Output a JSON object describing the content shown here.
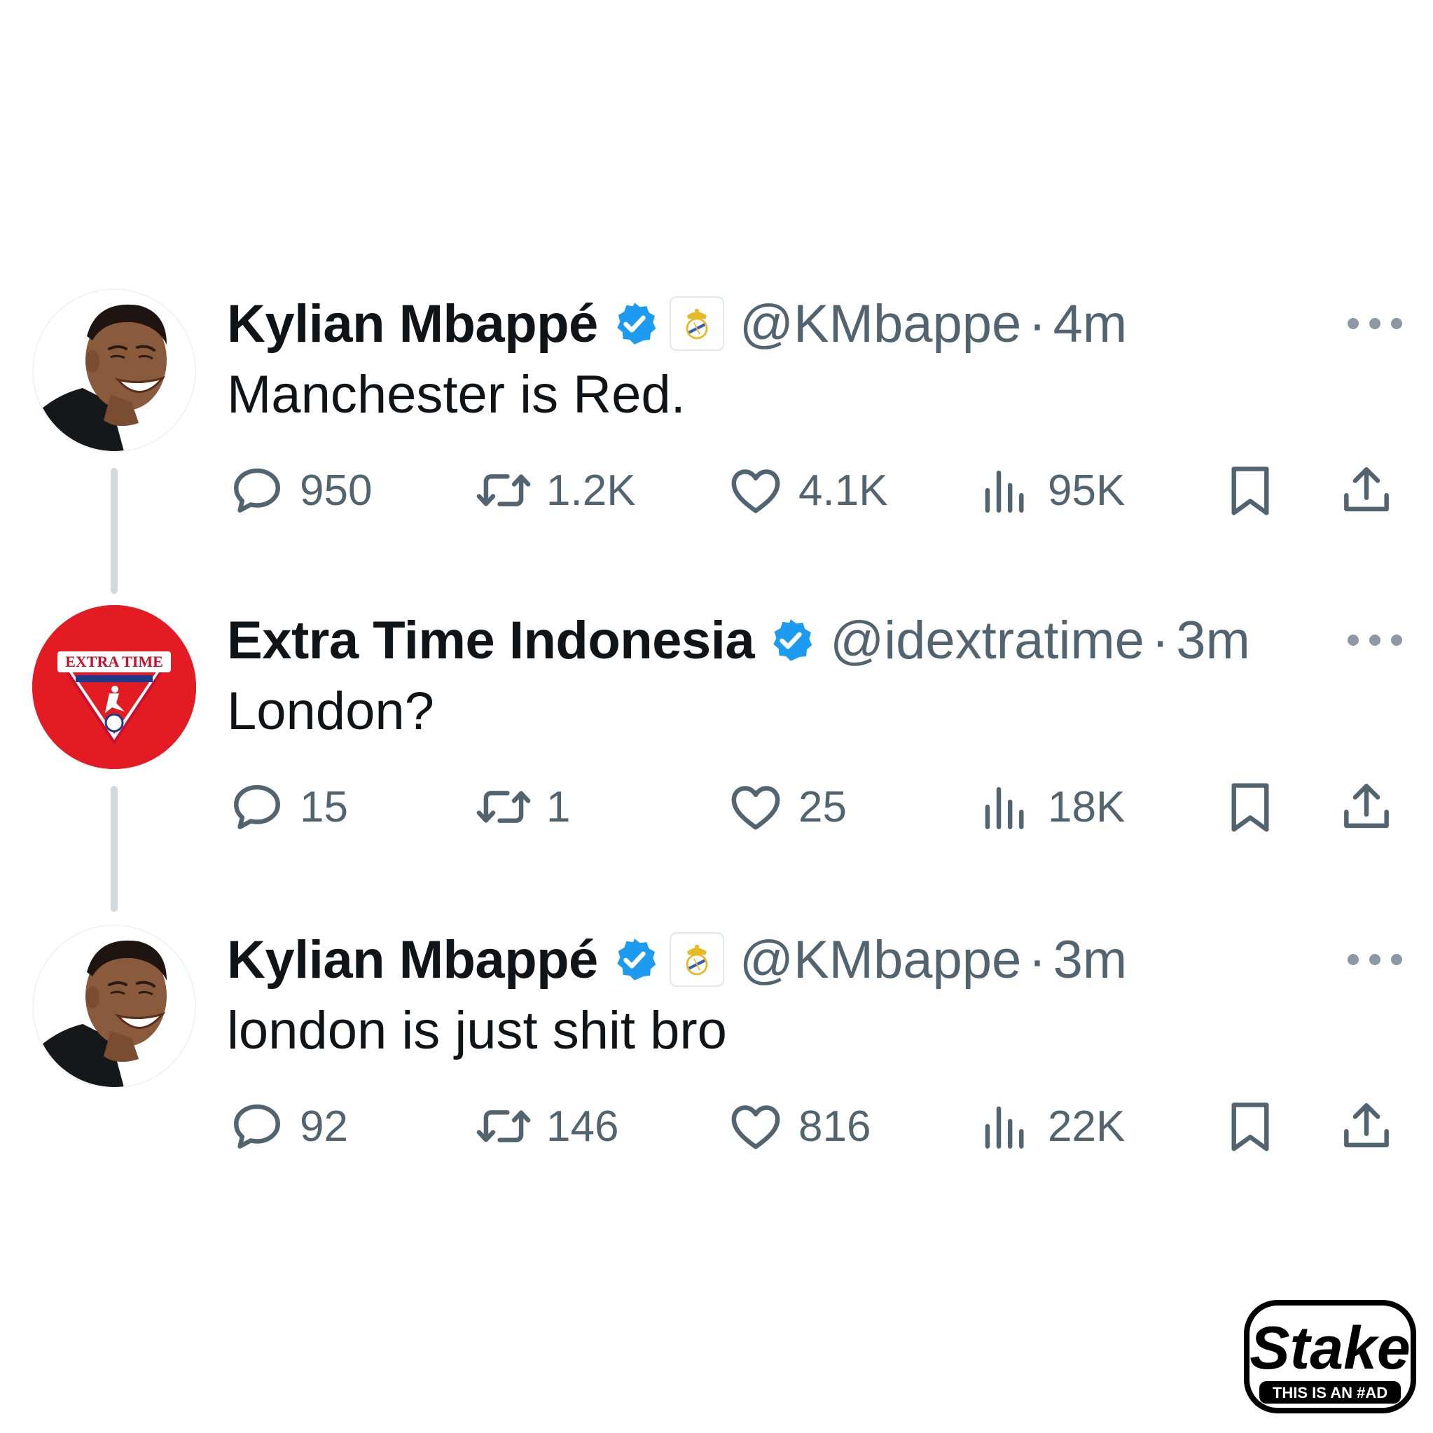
{
  "tweets": [
    {
      "name": "Kylian Mbappé",
      "handle": "@KMbappe",
      "dot": "·",
      "time": "4m",
      "text": "Manchester is Red.",
      "replies": "950",
      "retweets": "1.2K",
      "likes": "4.1K",
      "views": "95K",
      "avatar": "person-photo",
      "affiliate_badge": "real-madrid-crest"
    },
    {
      "name": "Extra Time Indonesia",
      "handle": "@idextratime",
      "dot": "·",
      "time": "3m",
      "text": "London?",
      "replies": "15",
      "retweets": "1",
      "likes": "25",
      "views": "18K",
      "avatar": "extratime-logo",
      "avatar_logo_text": "EXTRA TIME"
    },
    {
      "name": "Kylian Mbappé",
      "handle": "@KMbappe",
      "dot": "·",
      "time": "3m",
      "text": "london is just shit bro",
      "replies": "92",
      "retweets": "146",
      "likes": "816",
      "views": "22K",
      "avatar": "person-photo",
      "affiliate_badge": "real-madrid-crest"
    }
  ],
  "ad": {
    "brand": "Stake",
    "tagline": "THIS IS AN #AD"
  },
  "colors": {
    "text": "#0f1419",
    "muted": "#536471",
    "verified": "#1d9bf0",
    "thread_line": "#cfd9de",
    "brand_red": "#e31b23"
  },
  "icons": [
    "reply-icon",
    "retweet-icon",
    "like-icon",
    "views-icon",
    "bookmark-icon",
    "share-icon",
    "more-icon",
    "verified-badge-icon"
  ]
}
